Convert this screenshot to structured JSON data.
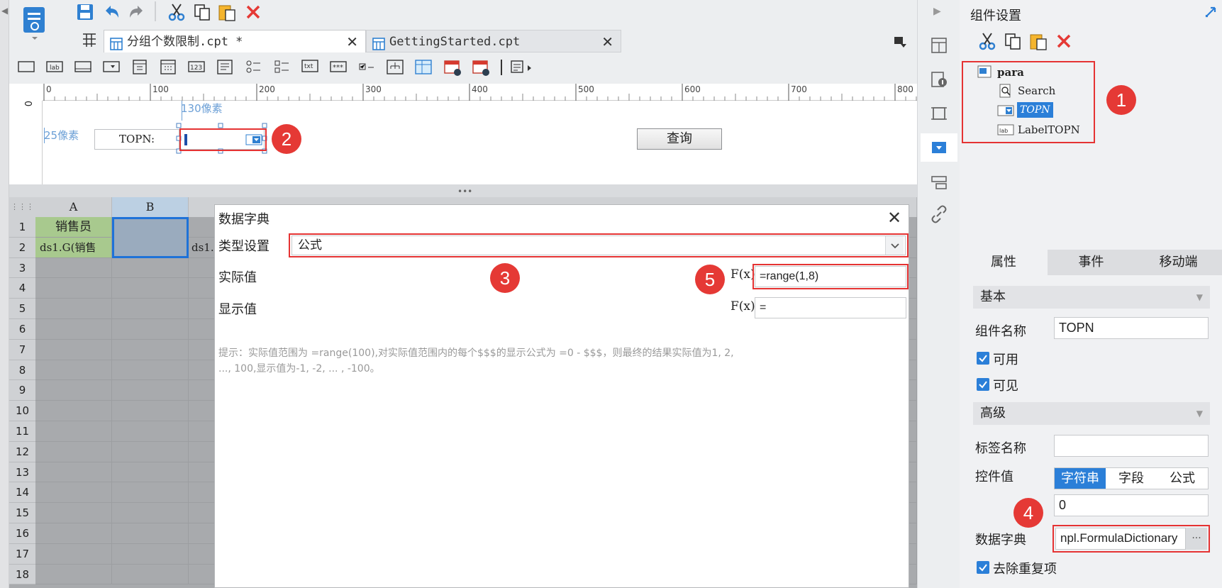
{
  "tabs": [
    {
      "label": "分组个数限制.cpt *"
    },
    {
      "label": "GettingStarted.cpt"
    }
  ],
  "toolbar": {
    "icons": [
      "save-icon",
      "undo-icon",
      "redo-icon",
      "cut-icon",
      "copy-icon",
      "paste-icon",
      "delete-icon"
    ]
  },
  "ruler": {
    "ticks": [
      "0",
      "100",
      "200",
      "300",
      "400",
      "500",
      "600",
      "700",
      "800"
    ]
  },
  "param_canvas": {
    "width_hint": "130像素",
    "height_hint": "25像素",
    "topn_label": "TOPN:",
    "query_button": "查询",
    "vertical_ruler_zero": "0"
  },
  "grid": {
    "columns": [
      "A",
      "B"
    ],
    "rows": [
      "1",
      "2",
      "3",
      "4",
      "5",
      "6",
      "7",
      "8",
      "9",
      "10",
      "11",
      "12",
      "13",
      "14",
      "15",
      "16",
      "17",
      "18"
    ],
    "a1": "销售员",
    "a2": "ds1.G(销售",
    "c2": "ds1."
  },
  "dialog": {
    "title": "数据字典",
    "type_label": "类型设置",
    "type_value": "公式",
    "actual_label": "实际值",
    "actual_value": "=range(1,8)",
    "display_label": "显示值",
    "display_value": "=",
    "fx_label": "F(x)",
    "hint_line1": "提示：实际值范围为 =range(100),对实际值范围内的每个$$$的显示公式为 =0 - $$$，则最终的结果实际值为1, 2,",
    "hint_line2": "..., 100,显示值为-1, -2, ... , -100。"
  },
  "badges": [
    "1",
    "2",
    "3",
    "4",
    "5"
  ],
  "right_panel": {
    "title": "组件设置",
    "tree": {
      "root": "para",
      "children": [
        "Search",
        "TOPN",
        "LabelTOPN"
      ]
    },
    "tabs": [
      "属性",
      "事件",
      "移动端"
    ],
    "basic_section": "基本",
    "widget_name_label": "组件名称",
    "widget_name_value": "TOPN",
    "enabled_label": "可用",
    "visible_label": "可见",
    "advanced_section": "高级",
    "tag_name_label": "标签名称",
    "tag_name_value": "",
    "control_value_label": "控件值",
    "control_value_modes": [
      "字符串",
      "字段",
      "公式"
    ],
    "control_value": "0",
    "dictionary_label": "数据字典",
    "dictionary_value": "npl.FormulaDictionary",
    "dictionary_button": "···",
    "dedupe_label": "去除重复项"
  },
  "colors": {
    "accent": "#2b7fd8",
    "highlight_red": "#e53935",
    "selection_blue": "#1e72d8"
  }
}
